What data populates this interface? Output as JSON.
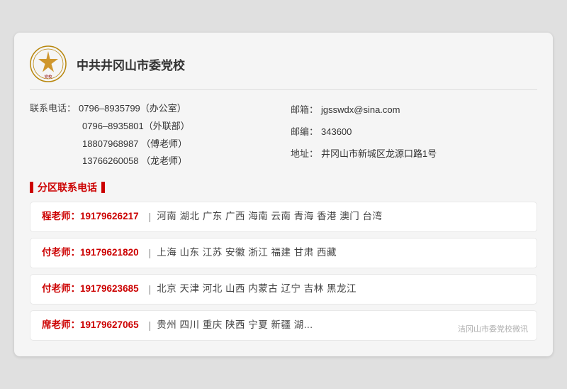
{
  "header": {
    "org_name": "中共井冈山市委党校",
    "logo_alt": "党校Logo"
  },
  "contact": {
    "left": [
      {
        "label": "联系电话：",
        "value": "0796–8935799（办公室）"
      },
      {
        "label": "",
        "value": "0796–8935801（外联部）"
      },
      {
        "label": "",
        "value": "18807968987 （傅老师）"
      },
      {
        "label": "",
        "value": "13766260058 （龙老师）"
      }
    ],
    "right": [
      {
        "label": "邮箱：",
        "value": "jgsswdx@sina.com"
      },
      {
        "label": "邮编：",
        "value": "343600"
      },
      {
        "label": "地址：",
        "value": "井冈山市新城区龙源口路1号"
      }
    ]
  },
  "section_title": "分区联系电话",
  "districts": [
    {
      "teacher": "程老师：",
      "phone": "19179626217",
      "regions": "河南   湖北   广东   广西   海南   云南   青海   香港   澳门   台湾"
    },
    {
      "teacher": "付老师：",
      "phone": "19179621820",
      "regions": "上海   山东   江苏   安徽   浙江   福建   甘肃   西藏"
    },
    {
      "teacher": "付老师：",
      "phone": "19179623685",
      "regions": "北京   天津   河北   山西   内蒙古   辽宁   吉林   黑龙江"
    },
    {
      "teacher": "席老师：",
      "phone": "19179627065",
      "regions": "贵州   四川   重庆   陕西   宁夏   新疆   湖..."
    }
  ],
  "watermark": "洁冈山市委党校微讯"
}
